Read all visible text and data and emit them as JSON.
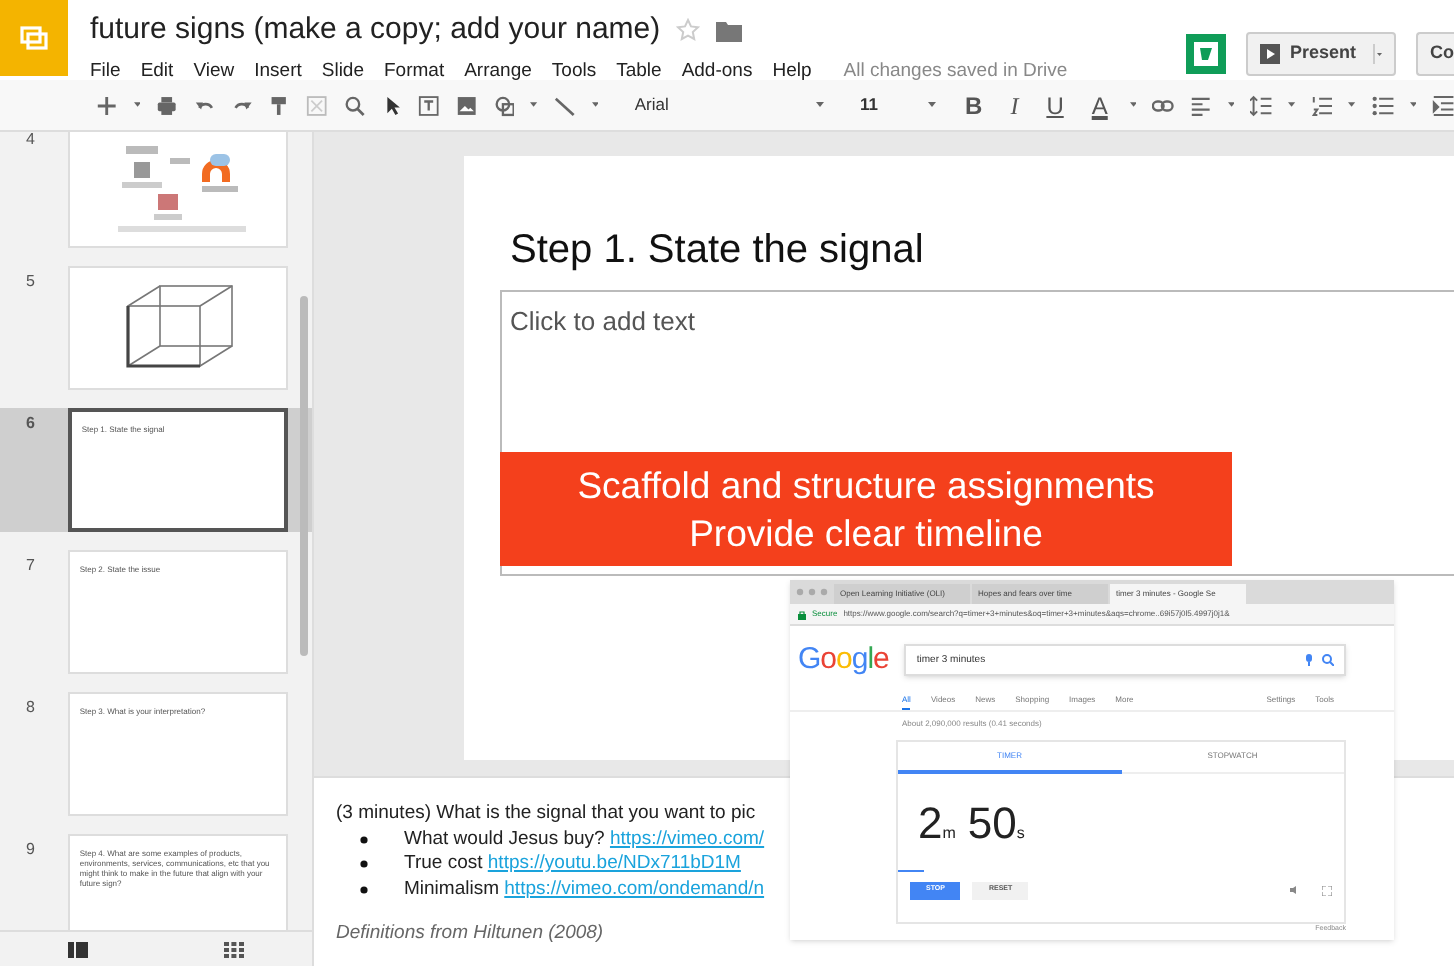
{
  "document": {
    "title": "future signs (make a copy; add your name)",
    "starred": false,
    "save_status": "All changes saved in Drive"
  },
  "menu": [
    "File",
    "Edit",
    "View",
    "Insert",
    "Slide",
    "Format",
    "Arrange",
    "Tools",
    "Table",
    "Add-ons",
    "Help"
  ],
  "header_buttons": {
    "present": "Present",
    "comments": "Co"
  },
  "toolbar": {
    "font": "Arial",
    "size": "11",
    "format_buttons": [
      "B",
      "I",
      "U",
      "A"
    ]
  },
  "filmstrip": [
    {
      "number": "4",
      "kind": "diagram",
      "selected": false
    },
    {
      "number": "5",
      "kind": "cube",
      "selected": false
    },
    {
      "number": "6",
      "kind": "text",
      "text": "Step 1. State the signal",
      "selected": true
    },
    {
      "number": "7",
      "kind": "text",
      "text": "Step 2. State the issue",
      "selected": false
    },
    {
      "number": "8",
      "kind": "text",
      "text": "Step 3. What is your interpretation?",
      "selected": false
    },
    {
      "number": "9",
      "kind": "text",
      "text": "Step 4. What are some examples of products, environments, services, communications, etc that you might think to make in the future that align with your future sign?",
      "selected": false
    }
  ],
  "slide": {
    "title": "Step 1. State the signal",
    "body_placeholder": "Click to add text",
    "banner_lines": [
      "Scaffold and structure assignments",
      "Provide clear timeline"
    ]
  },
  "browser": {
    "tabs": [
      {
        "label": "Open Learning Initiative (OLI)",
        "selected": false
      },
      {
        "label": "Hopes and fears over time",
        "selected": false
      },
      {
        "label": "timer 3 minutes - Google Se",
        "selected": true
      }
    ],
    "secure": "Secure",
    "url": "https://www.google.com/search?q=timer+3+minutes&oq=timer+3+minutes&aqs=chrome..69i57j0l5.4997j0j1&",
    "logo": "Google",
    "query": "timer 3 minutes",
    "search_tabs": [
      {
        "label": "All",
        "selected": true
      },
      {
        "label": "Videos",
        "selected": false
      },
      {
        "label": "News",
        "selected": false
      },
      {
        "label": "Shopping",
        "selected": false
      },
      {
        "label": "Images",
        "selected": false
      },
      {
        "label": "More",
        "selected": false
      }
    ],
    "tools": [
      "Settings",
      "Tools"
    ],
    "result_stats": "About 2,090,000 results (0.41 seconds)",
    "timer_tabs": [
      {
        "label": "TIMER",
        "selected": true
      },
      {
        "label": "STOPWATCH",
        "selected": false
      }
    ],
    "minutes": "2",
    "minutes_unit": "m",
    "seconds": "50",
    "seconds_unit": "s",
    "level": 0.06,
    "buttons": [
      "STOP",
      "RESET"
    ],
    "feedback": "Feedback"
  },
  "notes": {
    "intro": "(3 minutes) What is the signal that you want to pic",
    "bullets": [
      {
        "text": "What would Jesus buy? ",
        "link": "https://vimeo.com/"
      },
      {
        "text": "True cost ",
        "link": "https://youtu.be/NDx711bD1M"
      },
      {
        "text": "Minimalism ",
        "link": "https://vimeo.com/ondemand/n"
      }
    ],
    "footer": "Definitions from Hiltunen (2008)"
  }
}
